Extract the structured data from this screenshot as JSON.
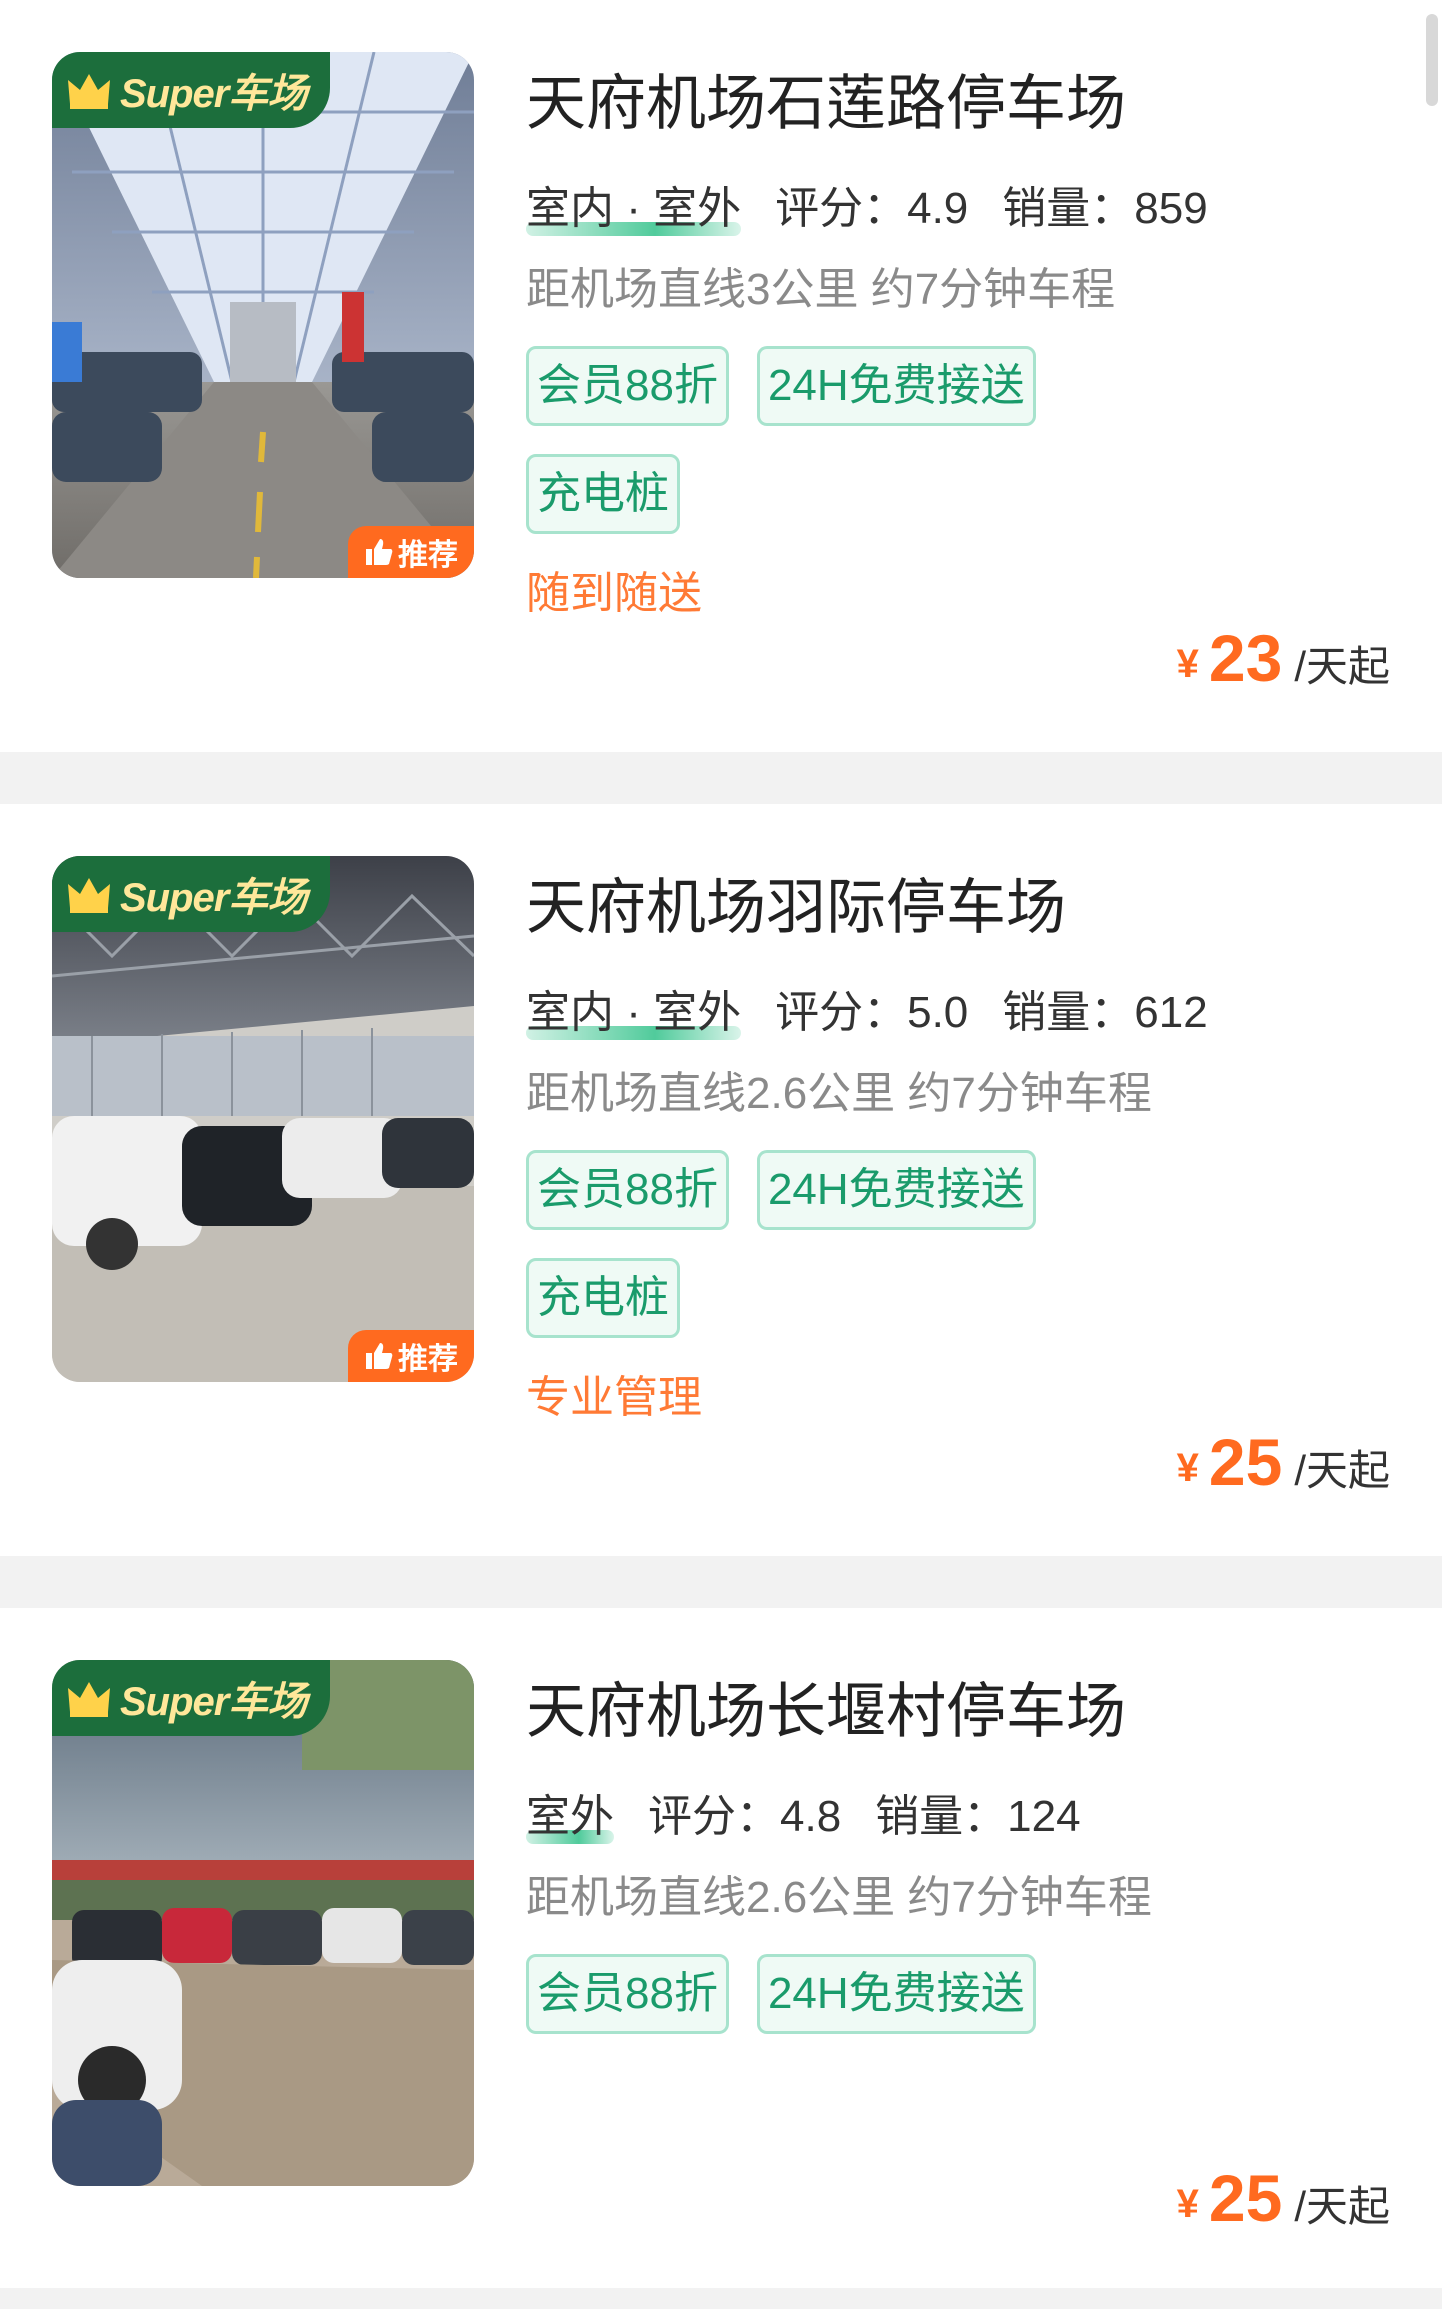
{
  "colors": {
    "accent_green": "#1a9b6b",
    "super_badge_bg": "#1c6e3c",
    "price_orange": "#ff6a1f",
    "feature_orange": "#ff7a35"
  },
  "lots": [
    {
      "badge": "Super车场",
      "recommend": "推荐",
      "title": "天府机场石莲路停车场",
      "type": "室内 · 室外",
      "rating": "评分：4.9",
      "sales": "销量：859",
      "distance": "距机场直线3公里 约7分钟车程",
      "tags": [
        "会员88折",
        "24H免费接送",
        "充电桩"
      ],
      "feature": "随到随送",
      "price": {
        "currency": "¥",
        "amount": "23",
        "unit": "/天起"
      }
    },
    {
      "badge": "Super车场",
      "recommend": "推荐",
      "title": "天府机场羽际停车场",
      "type": "室内 · 室外",
      "rating": "评分：5.0",
      "sales": "销量：612",
      "distance": "距机场直线2.6公里 约7分钟车程",
      "tags": [
        "会员88折",
        "24H免费接送",
        "充电桩"
      ],
      "feature": "专业管理",
      "price": {
        "currency": "¥",
        "amount": "25",
        "unit": "/天起"
      }
    },
    {
      "badge": "Super车场",
      "title": "天府机场长堰村停车场",
      "type": "室外",
      "rating": "评分：4.8",
      "sales": "销量：124",
      "distance": "距机场直线2.6公里 约7分钟车程",
      "tags": [
        "会员88折",
        "24H免费接送"
      ],
      "price": {
        "currency": "¥",
        "amount": "25",
        "unit": "/天起"
      }
    }
  ]
}
